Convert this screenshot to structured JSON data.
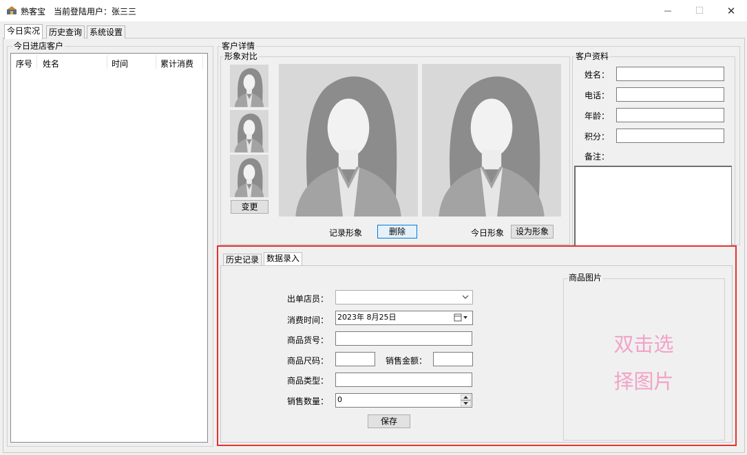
{
  "window": {
    "title": "熟客宝",
    "user_label": "当前登陆用户：张三三",
    "minimize": "—",
    "maximize": "☐",
    "close": "✕"
  },
  "tabs": [
    {
      "label": "今日实况",
      "active": true
    },
    {
      "label": "历史查询",
      "active": false
    },
    {
      "label": "系统设置",
      "active": false
    }
  ],
  "today_customers": {
    "group_title": "今日进店客户",
    "columns": [
      "序号",
      "姓名",
      "时间",
      "累计消费"
    ],
    "rows": []
  },
  "customer_detail": {
    "group_title": "客户详情",
    "image_compare": {
      "group_title": "形象对比",
      "change_button": "变更",
      "record_label": "记录形象",
      "delete_button": "删除",
      "today_label": "今日形象",
      "set_button": "设为形象"
    },
    "profile": {
      "group_title": "客户资料",
      "name_label": "姓名：",
      "phone_label": "电话：",
      "age_label": "年龄：",
      "points_label": "积分：",
      "note_label": "备注：",
      "name_value": "",
      "phone_value": "",
      "age_value": "",
      "points_value": "",
      "note_value": ""
    }
  },
  "lower_tabs": [
    {
      "label": "历史记录",
      "active": false
    },
    {
      "label": "数据录入",
      "active": true
    }
  ],
  "data_entry": {
    "clerk_label": "出单店员：",
    "clerk_value": "",
    "time_label": "消费时间：",
    "time_value": "2023年  8月25日",
    "item_no_label": "商品货号：",
    "item_no_value": "",
    "size_label": "商品尺码：",
    "size_value": "",
    "amount_label": "销售金额：",
    "amount_value": "",
    "type_label": "商品类型：",
    "type_value": "",
    "qty_label": "销售数量：",
    "qty_value": "0",
    "save_button": "保存",
    "goods_image_title": "商品图片",
    "goods_image_hint_line1": "双击选",
    "goods_image_hint_line2": "择图片"
  },
  "colors": {
    "highlight": "#e5312e",
    "hint_text": "#f2a3c6",
    "focus_border": "#0078d7"
  }
}
